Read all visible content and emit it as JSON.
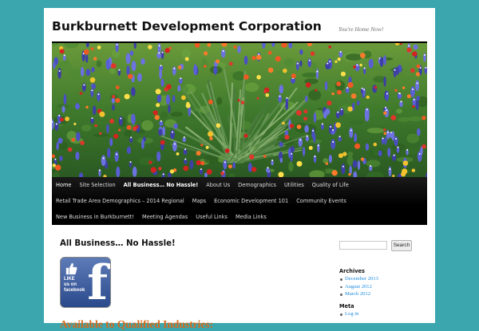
{
  "site": {
    "title": "Burkburnett Development Corporation",
    "description": "You're Home Now!"
  },
  "banner": {
    "alt": "wildflower field with bluebonnets and indian paintbrush"
  },
  "nav": {
    "row1": [
      {
        "label": "Home",
        "state": "home"
      },
      {
        "label": "Site Selection",
        "state": ""
      },
      {
        "label": "All Business… No Hassle!",
        "state": "current"
      },
      {
        "label": "About Us",
        "state": ""
      },
      {
        "label": "Demographics",
        "state": ""
      },
      {
        "label": "Utilities",
        "state": ""
      },
      {
        "label": "Quality of Life",
        "state": ""
      }
    ],
    "row2": [
      {
        "label": "Retail Trade Area Demographics – 2014 Regional",
        "state": ""
      },
      {
        "label": "Maps",
        "state": ""
      },
      {
        "label": "Economic Development 101",
        "state": ""
      },
      {
        "label": "Community Events",
        "state": ""
      }
    ],
    "row3": [
      {
        "label": "New Business in Burkburnett!",
        "state": ""
      },
      {
        "label": "Meeting Agendas",
        "state": ""
      },
      {
        "label": "Useful Links",
        "state": ""
      },
      {
        "label": "Media Links",
        "state": ""
      }
    ]
  },
  "content": {
    "entry_title": "All Business… No Hassle!",
    "fb_badge": {
      "line1": "LIKE",
      "line2": "us on",
      "line3": "facebook",
      "letter": "f"
    },
    "subheading": "Available to Qualified Industries:"
  },
  "sidebar": {
    "search": {
      "placeholder": "",
      "button_label": "Search"
    },
    "archives": {
      "title": "Archives",
      "items": [
        "December 2013",
        "August 2012",
        "March 2012"
      ]
    },
    "meta": {
      "title": "Meta",
      "items": [
        "Log in"
      ]
    }
  },
  "colors": {
    "background": "#3ba6ad",
    "link": "#1b8be0",
    "subheading": "#d66a1c",
    "nav_bg": "#000000"
  }
}
